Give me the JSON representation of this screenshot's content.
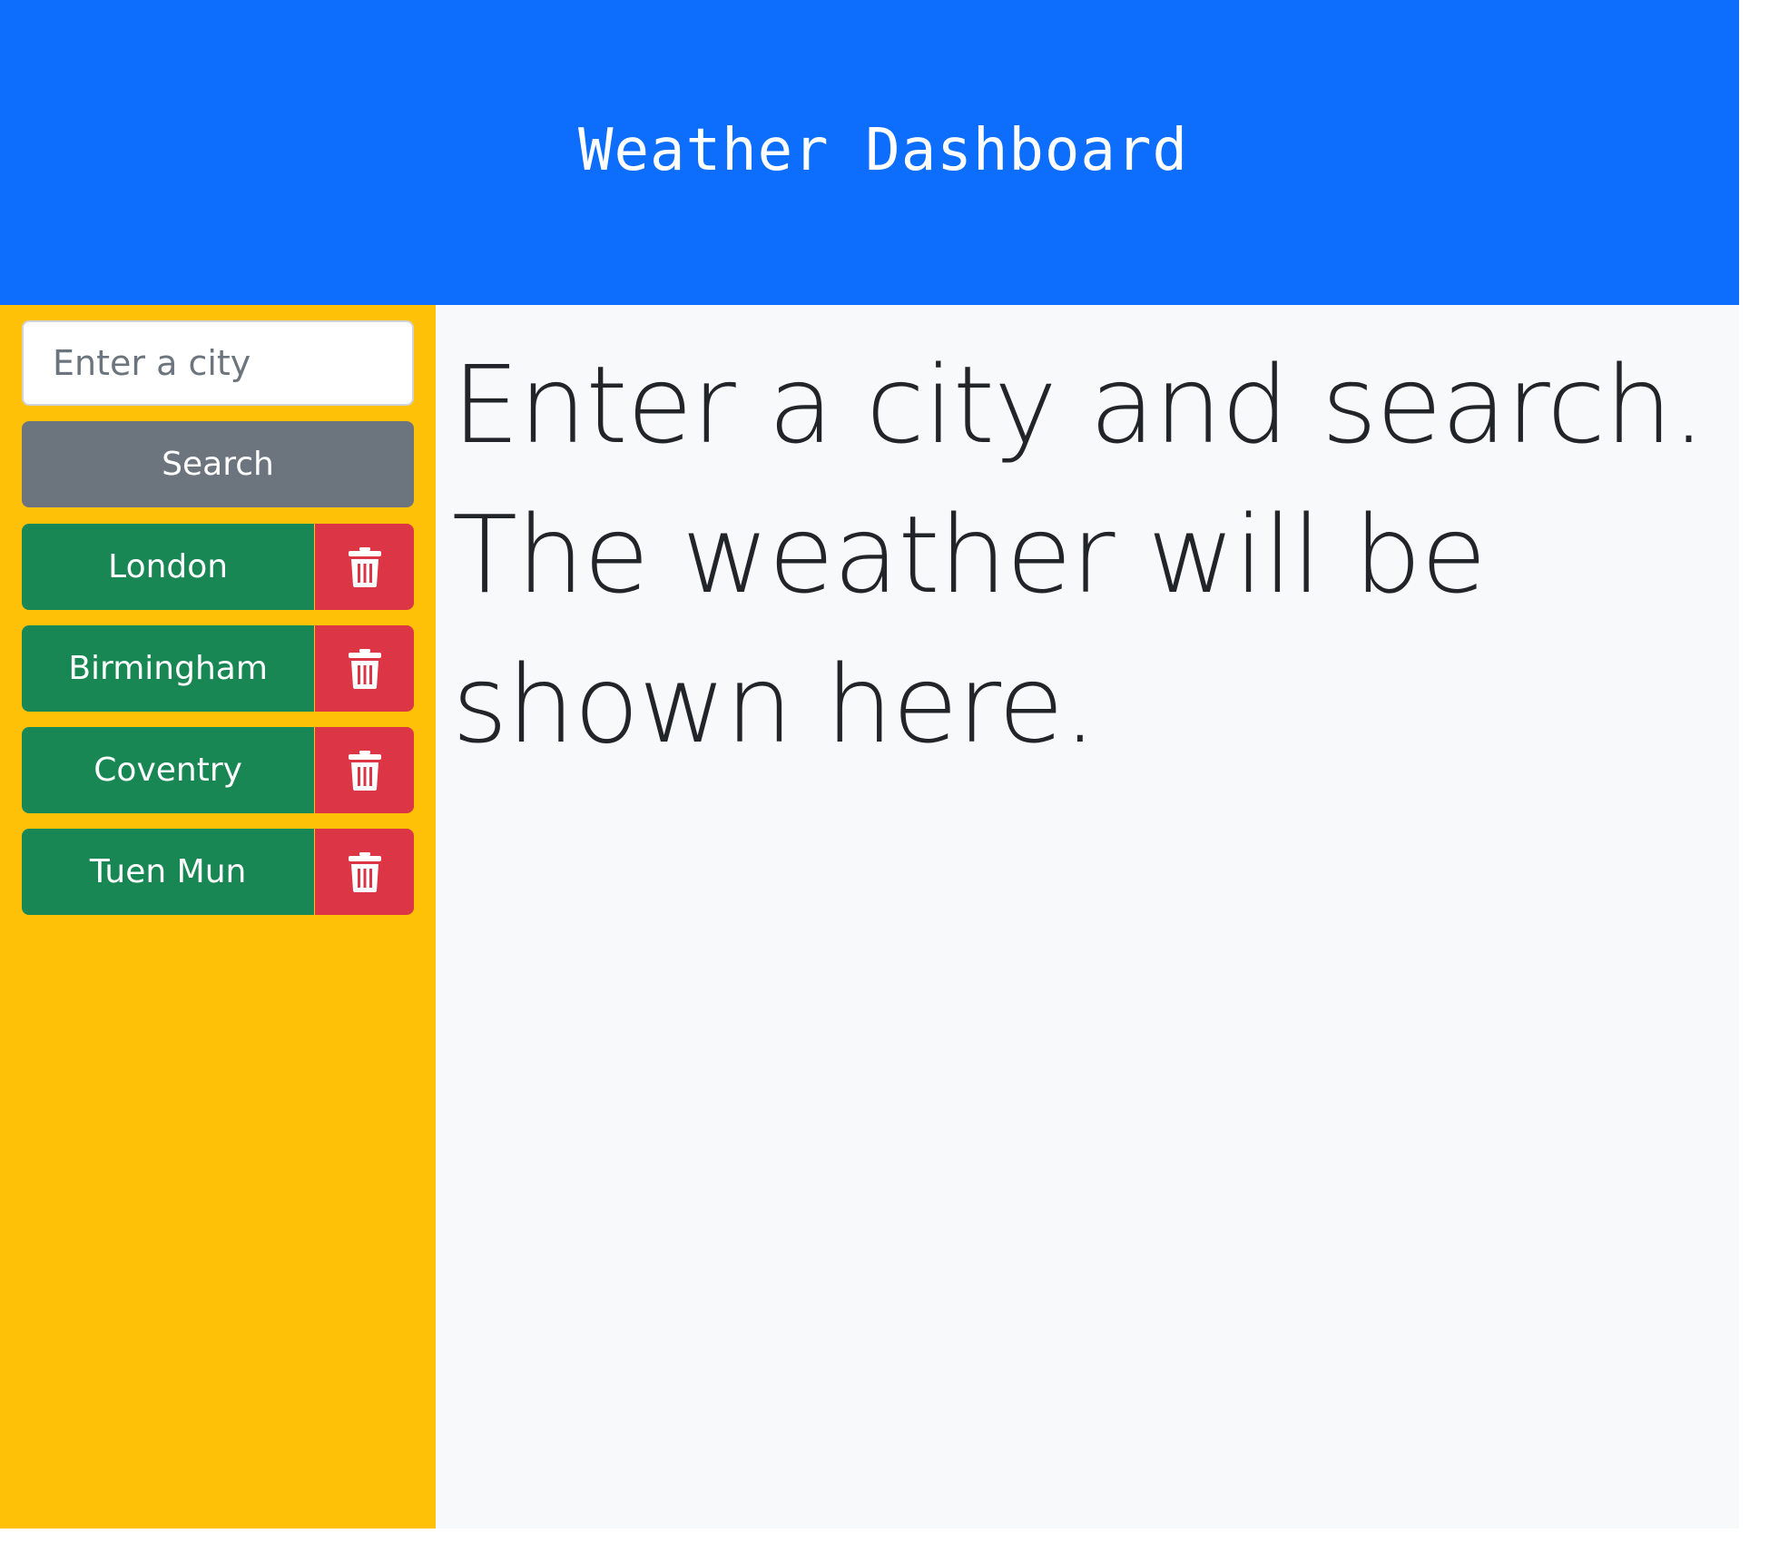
{
  "header": {
    "title": "Weather Dashboard"
  },
  "sidebar": {
    "search": {
      "placeholder": "Enter a city",
      "value": ""
    },
    "search_button_label": "Search",
    "cities": [
      {
        "label": "London",
        "delete_icon": "trash-icon"
      },
      {
        "label": "Birmingham",
        "delete_icon": "trash-icon"
      },
      {
        "label": "Coventry",
        "delete_icon": "trash-icon"
      },
      {
        "label": "Tuen Mun",
        "delete_icon": "trash-icon"
      }
    ]
  },
  "main": {
    "message": "Enter a city and search. The weather will be shown here."
  },
  "colors": {
    "header_bg": "#0d6efd",
    "sidebar_bg": "#ffc107",
    "main_bg": "#f8f9fa",
    "search_button": "#6c757d",
    "city_button": "#198754",
    "delete_button": "#dc3545"
  }
}
